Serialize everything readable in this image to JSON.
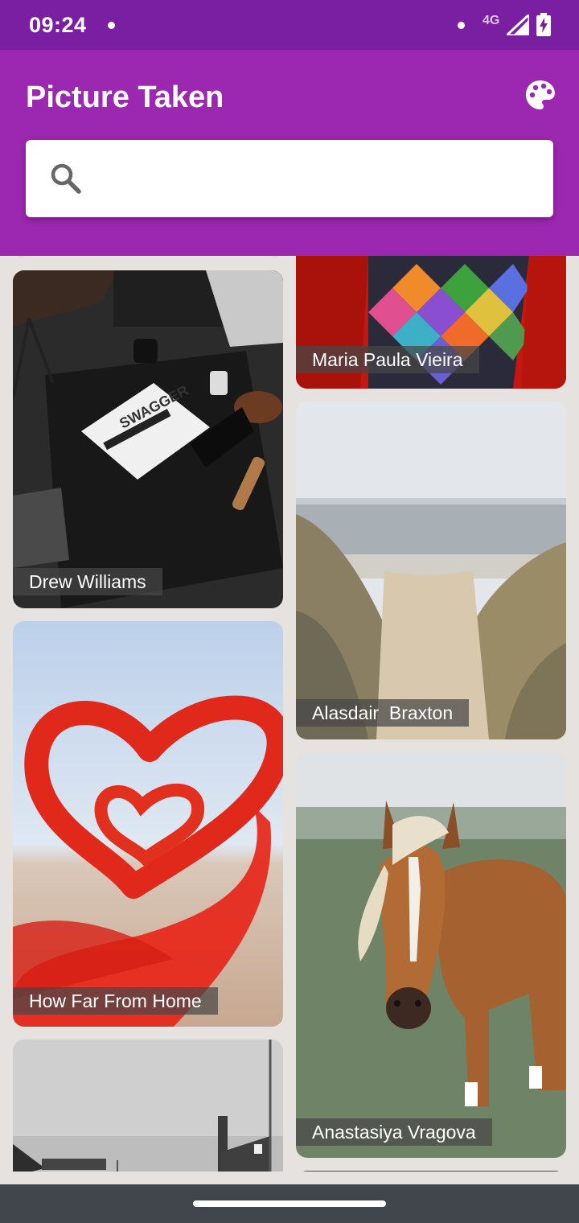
{
  "status_bar": {
    "time": "09:24",
    "network": "4G"
  },
  "app_bar": {
    "title": "Picture Taken",
    "theme_icon": "palette-icon"
  },
  "search": {
    "value": "",
    "placeholder": "",
    "icon": "search-icon"
  },
  "photos": [
    {
      "author": "Drew Williams"
    },
    {
      "author": "Maria Paula Vieira"
    },
    {
      "author": "Alasdair  Braxton"
    },
    {
      "author": "How Far From Home"
    },
    {
      "author": "Anastasiya Vragova"
    }
  ],
  "colors": {
    "status_bar": "#7b1fa2",
    "app_bar": "#9c27b0",
    "background": "#e6e2df",
    "nav_bar": "#41464d"
  }
}
